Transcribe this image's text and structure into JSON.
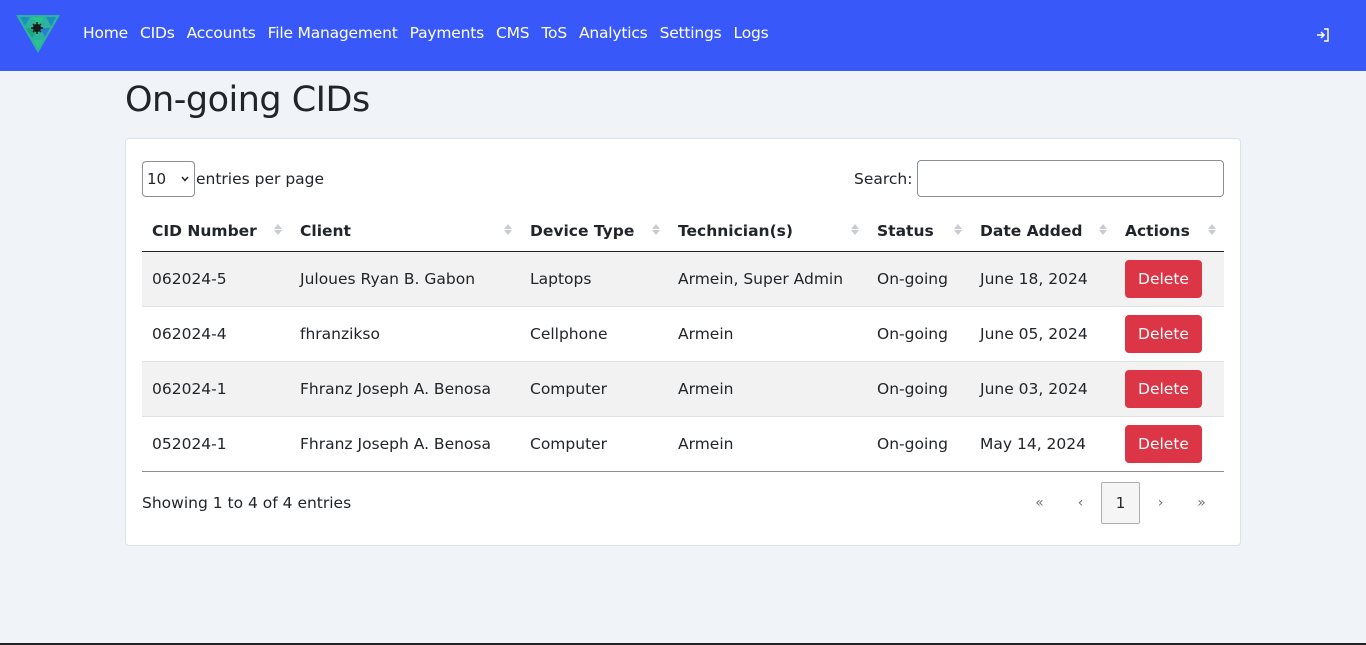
{
  "nav": {
    "links": [
      "Home",
      "CIDs",
      "Accounts",
      "File Management",
      "Payments",
      "CMS",
      "ToS",
      "Analytics",
      "Settings",
      "Logs"
    ],
    "logout_icon": "logout-icon"
  },
  "colors": {
    "navbar": "#3858f9",
    "delete": "#dc3545"
  },
  "page": {
    "title": "On-going CIDs"
  },
  "controls": {
    "length_value": "10",
    "length_label": "entries per page",
    "search_label": "Search:",
    "search_value": ""
  },
  "table": {
    "headers": [
      "CID Number",
      "Client",
      "Device Type",
      "Technician(s)",
      "Status",
      "Date Added",
      "Actions"
    ],
    "rows": [
      [
        "062024-5",
        "Juloues Ryan B. Gabon",
        "Laptops",
        "Armein, Super Admin",
        "On-going",
        "June 18, 2024",
        "Delete"
      ],
      [
        "062024-4",
        "fhranzikso",
        "Cellphone",
        "Armein",
        "On-going",
        "June 05, 2024",
        "Delete"
      ],
      [
        "062024-1",
        "Fhranz Joseph A. Benosa",
        "Computer",
        "Armein",
        "On-going",
        "June 03, 2024",
        "Delete"
      ],
      [
        "052024-1",
        "Fhranz Joseph A. Benosa",
        "Computer",
        "Armein",
        "On-going",
        "May 14, 2024",
        "Delete"
      ]
    ]
  },
  "footer": {
    "info": "Showing 1 to 4 of 4 entries",
    "pages": [
      "«",
      "‹",
      "1",
      "›",
      "»"
    ]
  }
}
